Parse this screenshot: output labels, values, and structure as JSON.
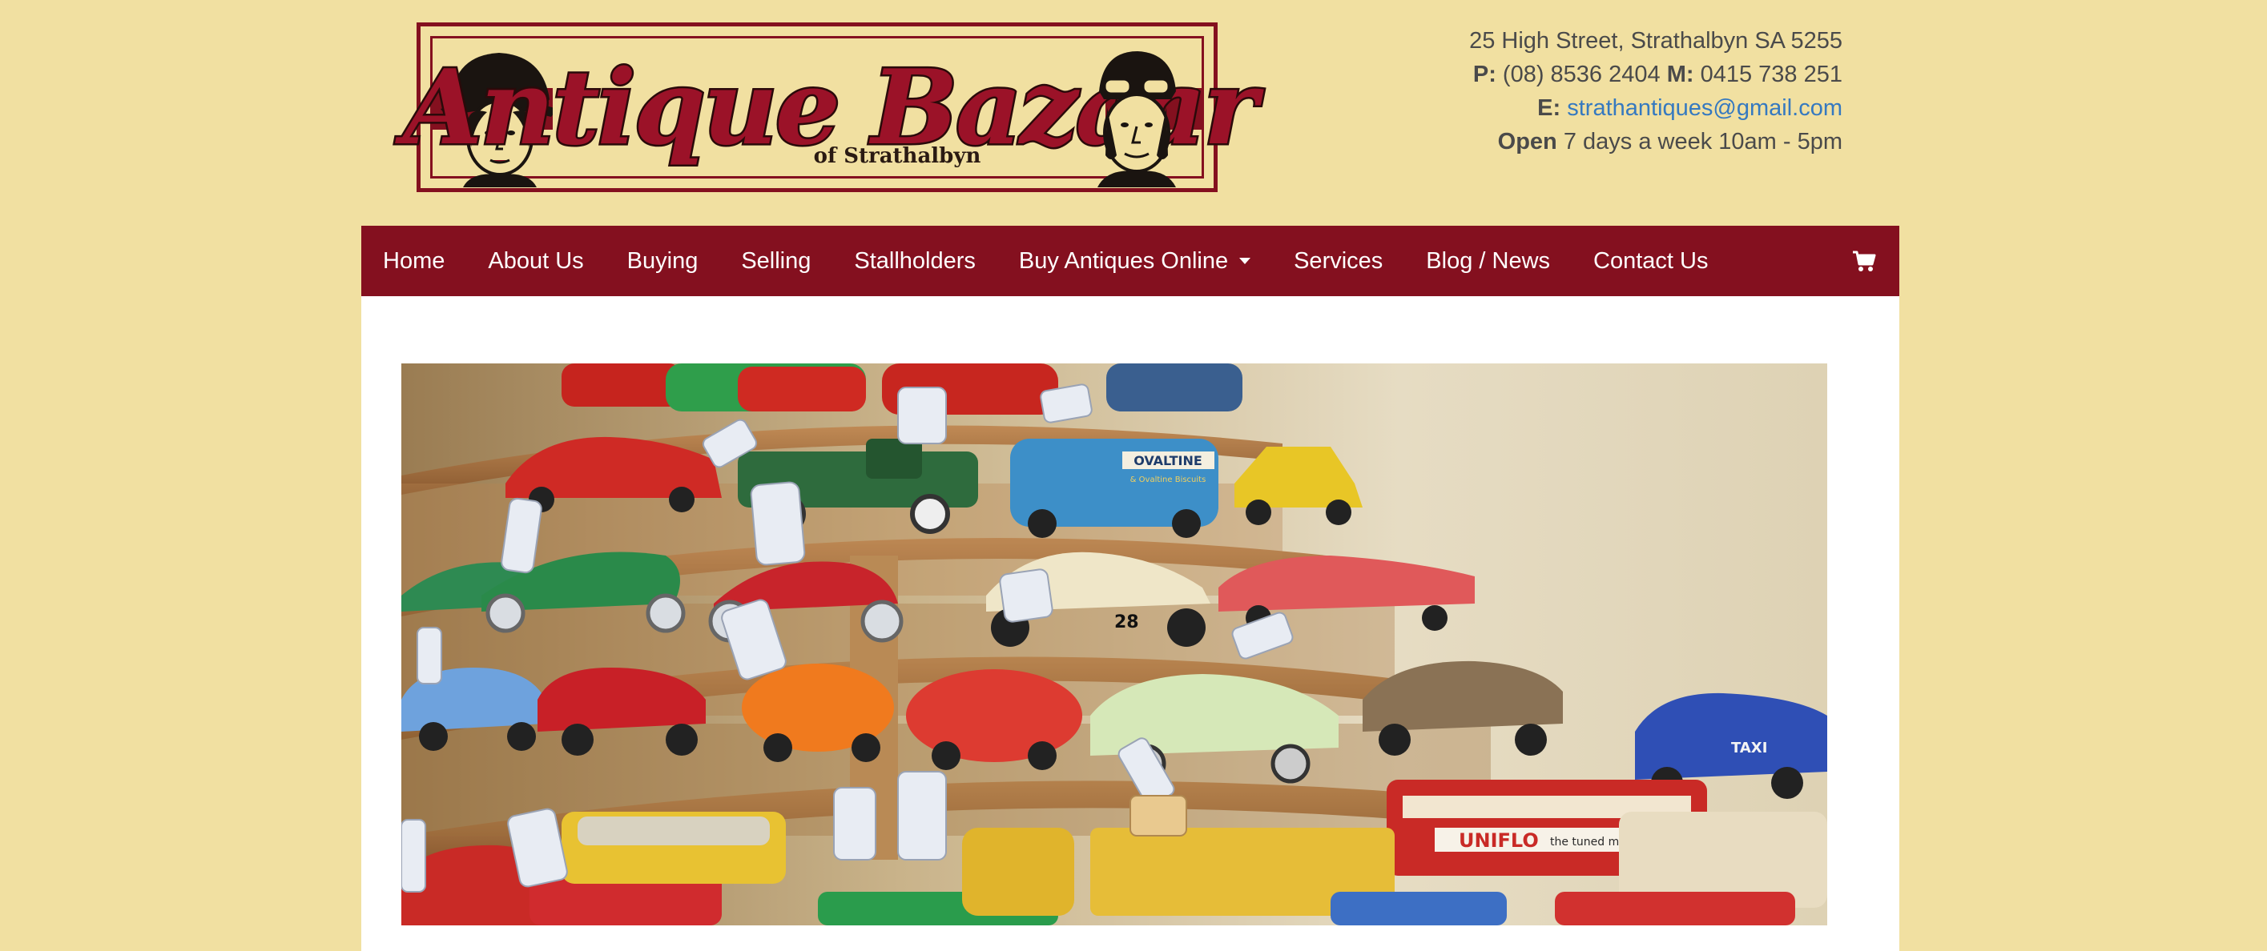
{
  "header": {
    "logo": {
      "title": "Antique Bazaar",
      "subtitle": "of Strathalbyn"
    },
    "contact": {
      "address": "25 High Street, Strathalbyn SA 5255",
      "phone_label": "P:",
      "phone": "(08) 8536 2404",
      "mobile_label": "M:",
      "mobile": "0415 738 251",
      "email_label": "E:",
      "email": "strathantiques@gmail.com",
      "hours_label": "Open",
      "hours": "7 days a week 10am - 5pm"
    }
  },
  "nav": {
    "items": [
      {
        "label": "Home"
      },
      {
        "label": "About Us"
      },
      {
        "label": "Buying"
      },
      {
        "label": "Selling"
      },
      {
        "label": "Stallholders"
      },
      {
        "label": "Buy Antiques Online"
      },
      {
        "label": "Services"
      },
      {
        "label": "Blog / News"
      },
      {
        "label": "Contact Us"
      }
    ],
    "cart_icon": "shopping-cart-icon"
  },
  "hero": {
    "image_label": "OVALTINE",
    "image_sublabel": "& Ovaltine Biscuits",
    "car_number": "28",
    "bus_brand": "UNIFLO",
    "bus_slogan": "the tuned motor oil",
    "taxi_label": "TAXI"
  },
  "colors": {
    "background": "#f1e0a1",
    "nav": "#84101f",
    "link": "#3579c0",
    "text": "#4a4a4a"
  }
}
